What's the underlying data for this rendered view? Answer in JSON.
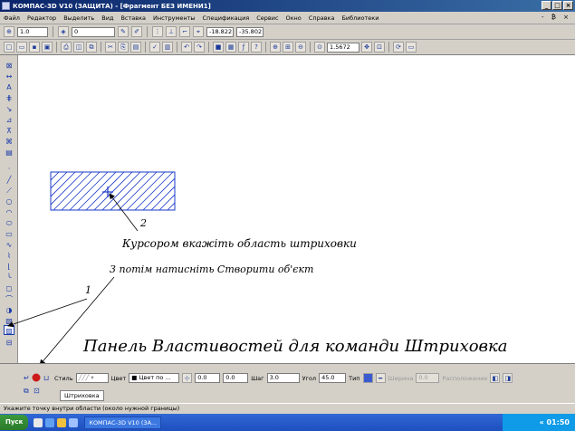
{
  "window": {
    "title": "КОМПАС-3D V10 (ЗАЩИТА) - [Фрагмент БЕЗ ИМЕНИ1]",
    "min": "_",
    "max": "□",
    "close": "×"
  },
  "menu": {
    "items": [
      "Файл",
      "Редактор",
      "Выделить",
      "Вид",
      "Вставка",
      "Инструменты",
      "Спецификация",
      "Сервис",
      "Окно",
      "Справка",
      "Библиотеки"
    ],
    "doc_controls": "- ₿ ×"
  },
  "toolbar1": {
    "scale": "1.0",
    "layer": "0",
    "coord_x": "-18.822",
    "coord_y": "-35.802"
  },
  "toolbar2": {
    "zoom": "1.5672"
  },
  "properties": {
    "style_label": "Стиль",
    "color_label": "Цвет",
    "color_value": "Цвет по ...",
    "x_value": "0.0",
    "y_value": "0.0",
    "step_label": "Шаг",
    "step_value": "3.0",
    "angle_label": "Угол",
    "angle_value": "45.0",
    "type_label": "Тип",
    "width_label": "Ширина",
    "width_value": "0.0",
    "placement_label": "Расположение",
    "tab_label": "Штриховка"
  },
  "status": {
    "hint": "Укажите точку внутри области (около нужной границы)"
  },
  "taskbar": {
    "start": "Пуск",
    "task": "КОМПАС-3D V10 (ЗА...",
    "clock": "01:50",
    "lang": "«"
  },
  "annotations": {
    "label_1": "1",
    "label_2": "2",
    "step2_text": "Курсором вкажіть область штриховки",
    "step3_text": "3 потім натисніть Створити об'єкт",
    "panel_caption": "Панель Властивостей для команди Штриховка"
  },
  "colors": {
    "hatch_blue": "#1a3ac8",
    "title_blue": "#0a246a",
    "panel_gray": "#d4d0c8"
  }
}
